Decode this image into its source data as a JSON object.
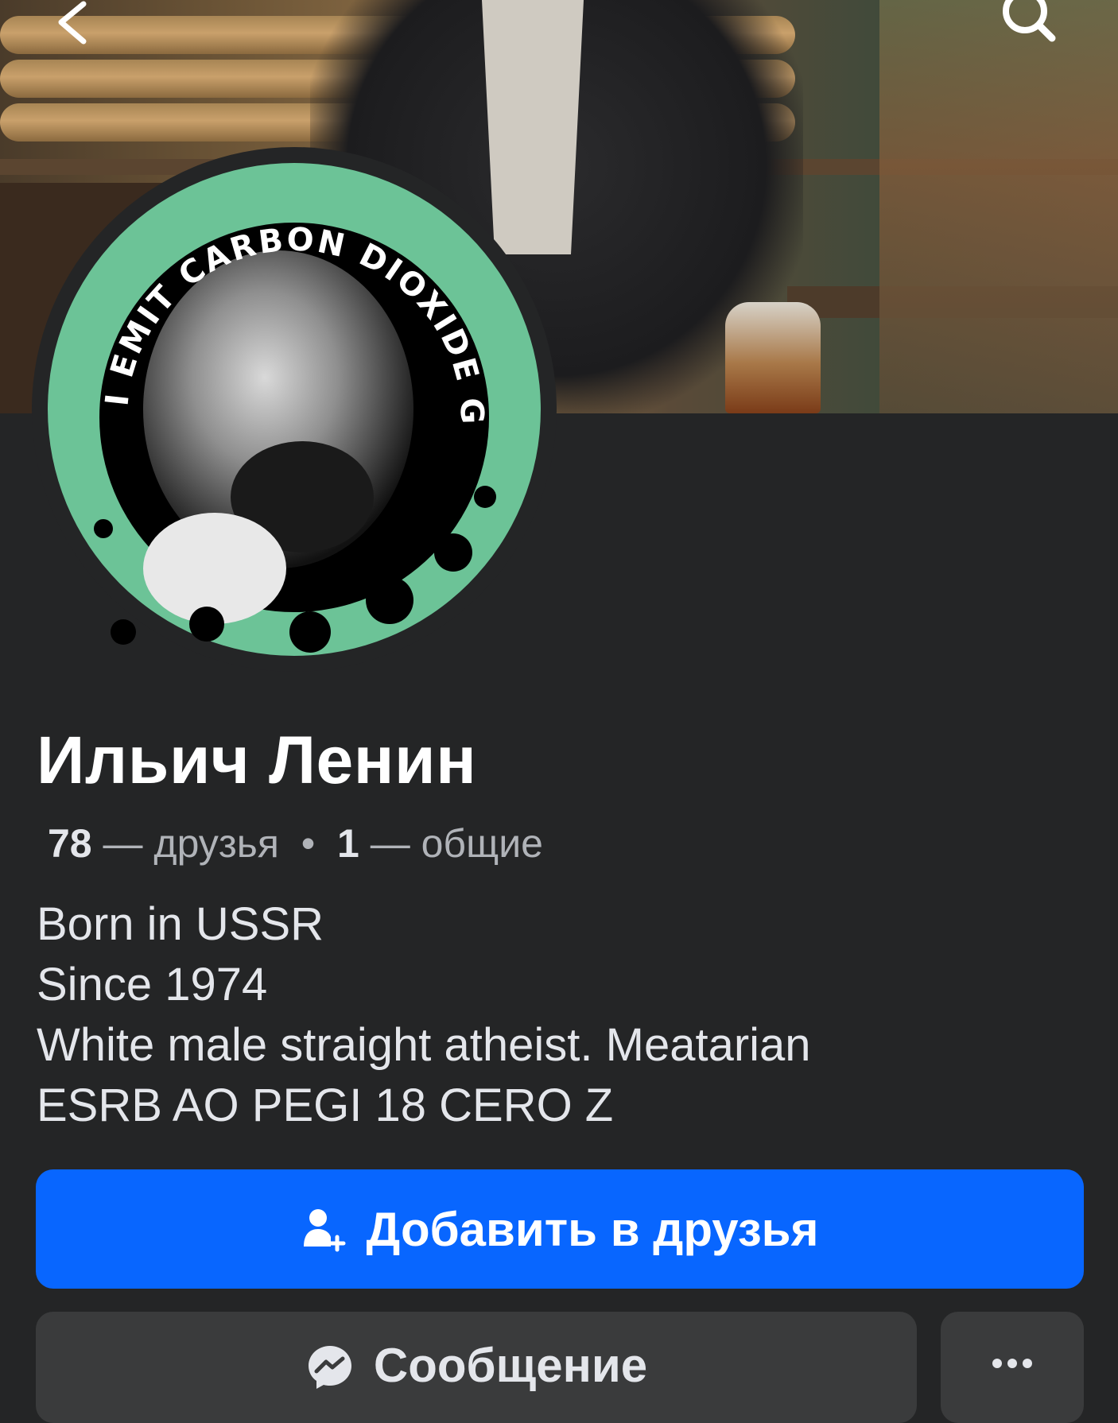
{
  "header": {
    "back_icon": "chevron-left-icon",
    "search_icon": "search-icon"
  },
  "avatar": {
    "ring_text": "I EMIT CARBON DIOXIDE GAS",
    "ring_color": "#6cc397"
  },
  "profile": {
    "name": "Ильич Ленин",
    "friends_count": "78",
    "friends_label": "— друзья",
    "separator": "•",
    "mutual_count": "1",
    "mutual_label": "— общие",
    "bio": [
      "Born in USSR",
      "Since 1974",
      "White male straight atheist. Meatarian",
      "ESRB AO PEGI 18 CERO Z"
    ]
  },
  "actions": {
    "add_friend_label": "Добавить в друзья",
    "add_friend_icon": "add-friend-icon",
    "message_label": "Сообщение",
    "message_icon": "messenger-icon",
    "more_icon": "more-icon"
  },
  "colors": {
    "primary": "#0866ff",
    "background": "#242526",
    "secondary_button": "#3a3b3c"
  }
}
